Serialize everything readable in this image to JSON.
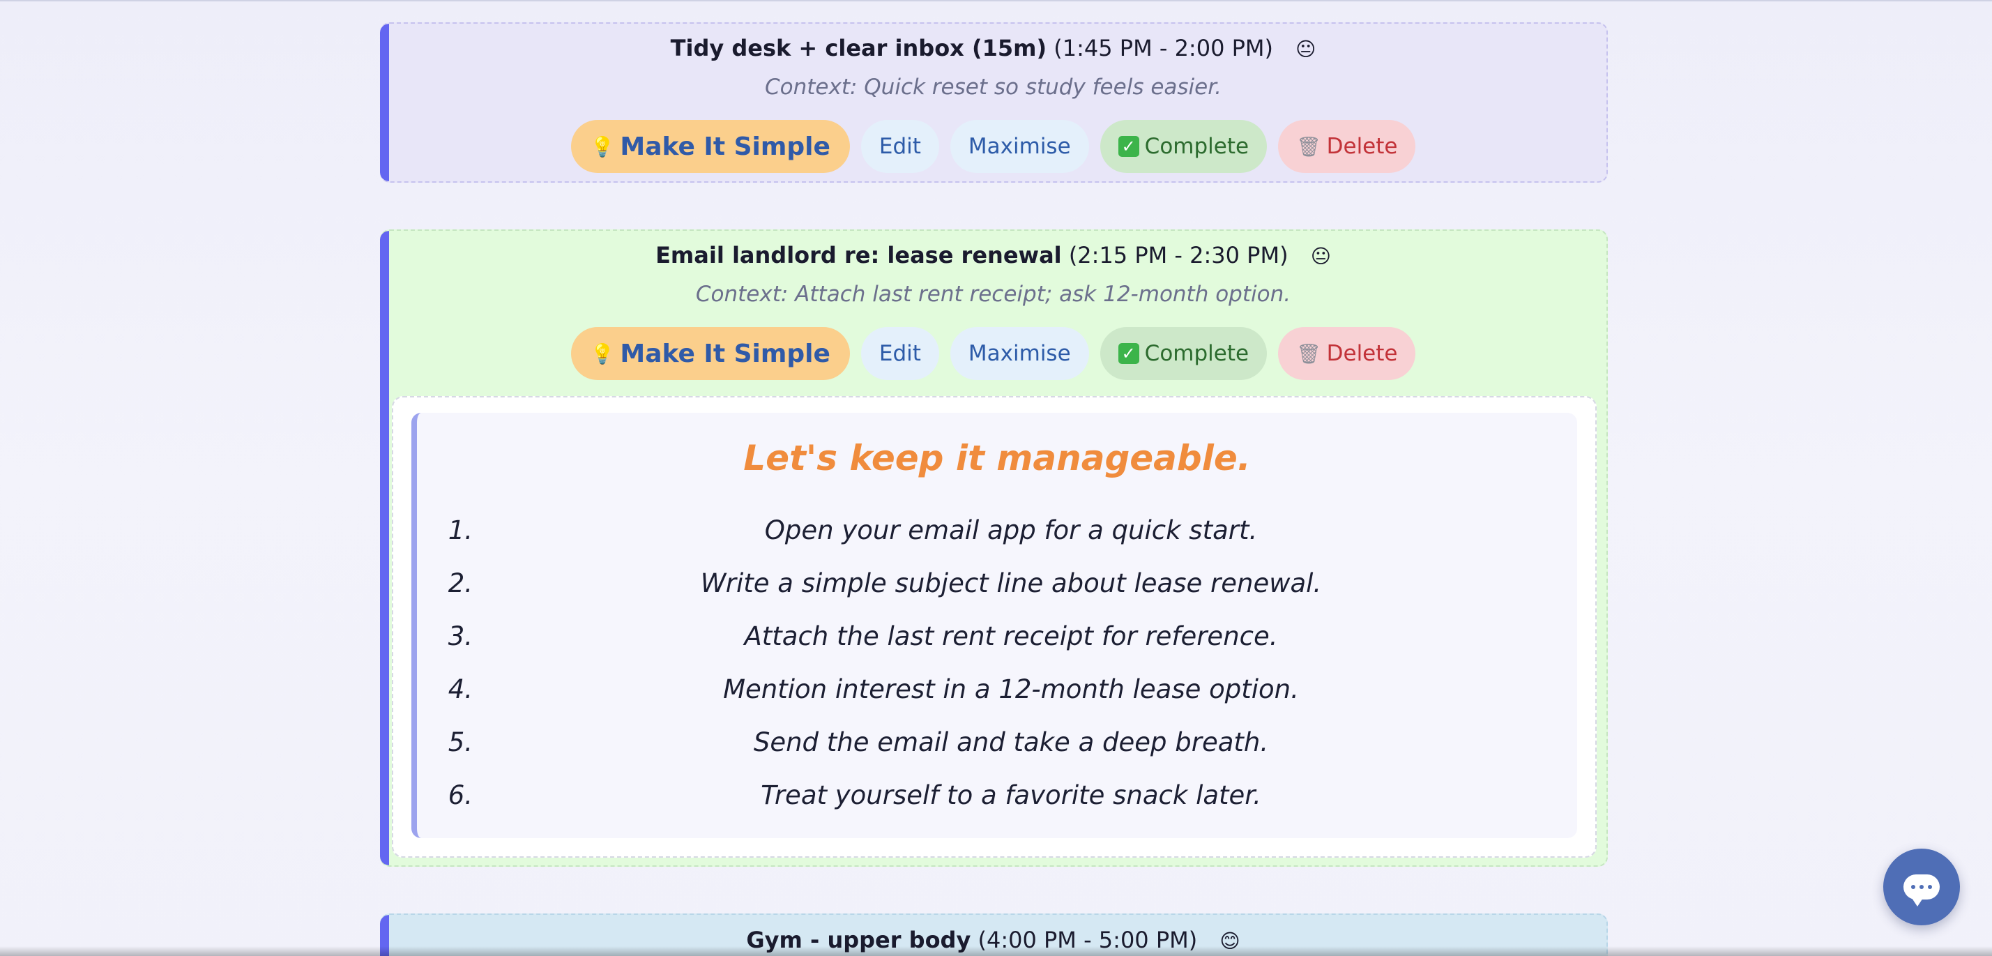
{
  "tasks": [
    {
      "title": "Tidy desk + clear inbox (15m)",
      "time": "(1:45 PM - 2:00 PM)",
      "emoji": "😐",
      "context": "Context: Quick reset so study feels easier."
    },
    {
      "title": "Email landlord re: lease renewal",
      "time": "(2:15 PM - 2:30 PM)",
      "emoji": "😐",
      "context": "Context: Attach last rent receipt; ask 12-month option.",
      "simplified": {
        "heading": "Let's keep it manageable.",
        "steps": [
          {
            "num": "1.",
            "text": "Open your email app for a quick start."
          },
          {
            "num": "2.",
            "text": "Write a simple subject line about lease renewal."
          },
          {
            "num": "3.",
            "text": "Attach the last rent receipt for reference."
          },
          {
            "num": "4.",
            "text": "Mention interest in a 12-month lease option."
          },
          {
            "num": "5.",
            "text": "Send the email and take a deep breath."
          },
          {
            "num": "6.",
            "text": "Treat yourself to a favorite snack later."
          }
        ]
      }
    },
    {
      "title": "Gym - upper body",
      "time": "(4:00 PM - 5:00 PM)",
      "emoji": "😊"
    }
  ],
  "buttons": {
    "make_simple": "Make It Simple",
    "edit": "Edit",
    "maximise": "Maximise",
    "complete": "Complete",
    "delete": "Delete"
  },
  "icons": {
    "bulb": "💡",
    "check": "✓",
    "bin": "🗑"
  },
  "colors": {
    "accent": "#6366f1",
    "card_1_bg": "#e8e6f8",
    "card_2_bg": "#e2fbdc",
    "card_3_bg": "#d5e8f3",
    "heading_orange": "#f08c3d",
    "chat_button": "#4f6eb6"
  }
}
